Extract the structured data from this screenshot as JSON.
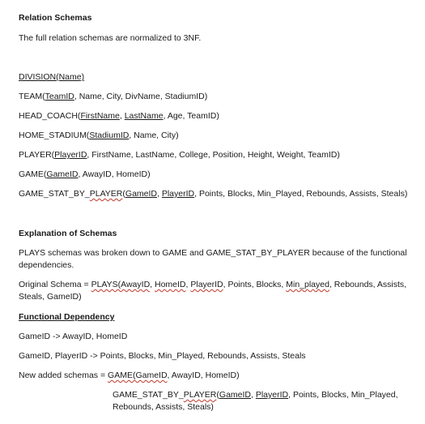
{
  "section1": {
    "title": "Relation Schemas",
    "intro": "The full relation schemas are normalized to 3NF."
  },
  "division": {
    "key": "DIVISION(Name)"
  },
  "team": {
    "pre": "TEAM(",
    "key": "TeamID",
    "rest": ", Name, City, DivName, StadiumID)"
  },
  "head_coach": {
    "pre": "HEAD_COACH(",
    "key1": "FirstName",
    "sep": ", ",
    "key2": "LastName",
    "rest": ", Age, TeamID)"
  },
  "home_stadium": {
    "pre": "HOME_STADIUM(",
    "key": "StadiumID",
    "rest": ", Name, City)"
  },
  "player": {
    "pre": "PLAYER(",
    "key": "PlayerID",
    "rest": ", FirstName, LastName, College, Position, Height, Weight, TeamID)"
  },
  "game": {
    "pre": "GAME(",
    "key": "GameID",
    "rest": ", AwayID, HomeID)"
  },
  "game_stat": {
    "pre": "GAME_STAT_BY_",
    "squig": "PLAYER",
    "paren": "(",
    "key1": "GameID",
    "sep": ", ",
    "key2": "PlayerID",
    "rest": ", Points, Blocks, Min_Played, Rebounds, Assists, Steals)"
  },
  "section2": {
    "title": "Explanation of Schemas",
    "para": "PLAYS schemas was broken down to GAME and GAME_STAT_BY_PLAYER because of the functional dependencies."
  },
  "original": {
    "pre": "Original Schema = ",
    "s1": "PLAYS(AwayID",
    "c1": ", ",
    "s2": "HomeID",
    "c2": ", ",
    "s3": "PlayerID",
    "mid": ", Points, Blocks, ",
    "s4": "Min_played",
    "rest": ", Rebounds, Assists, Steals, GameID)"
  },
  "fd": {
    "title": "Functional Dependency",
    "line1": "GameID -> AwayID, HomeID",
    "line2": "GameID, PlayerID -> Points, Blocks, Min_Played, Rebounds, Assists, Steals"
  },
  "new_schemas": {
    "pre": "New added schemas = ",
    "squig": "GAME(GameID",
    "rest": ", AwayID, HomeID)",
    "g_pre": "GAME_STAT_BY_",
    "g_squig": "PLAYER",
    "g_paren": "(",
    "g_key1": "GameID",
    "g_sep": ", ",
    "g_key2": "PlayerID",
    "g_rest": ", Points, Blocks, Min_Played, Rebounds, Assists, Steals)"
  }
}
